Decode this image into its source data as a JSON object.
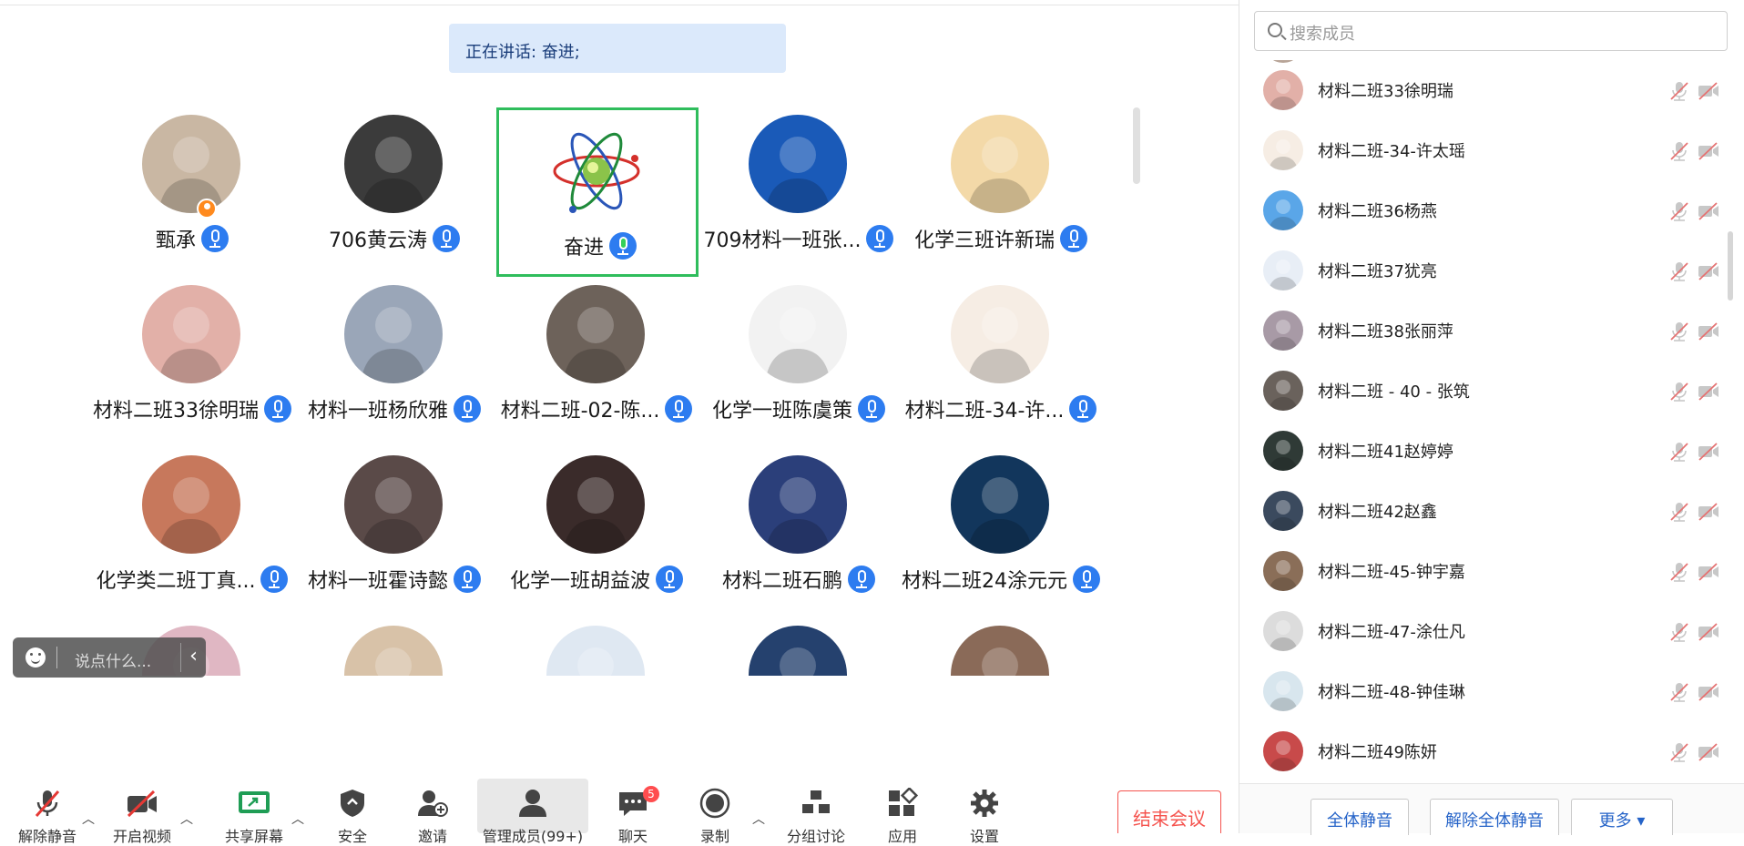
{
  "speaking": {
    "text": "正在讲话: 奋进;"
  },
  "grid": {
    "tiles": [
      {
        "name": "甄承",
        "speaking": false,
        "host": true,
        "color": "#c9b7a3"
      },
      {
        "name": "706黄云涛",
        "speaking": false,
        "host": false,
        "color": "#3b3b3b"
      },
      {
        "name": "奋进",
        "speaking": true,
        "host": false,
        "color": "#ffffff"
      },
      {
        "name": "709材料一班张...",
        "speaking": false,
        "host": false,
        "color": "#1a5ab8"
      },
      {
        "name": "化学三班许新瑞",
        "speaking": false,
        "host": false,
        "color": "#f3d9a8"
      },
      {
        "name": "材料二班33徐明瑞",
        "speaking": false,
        "host": false,
        "color": "#e2b0a8"
      },
      {
        "name": "材料一班杨欣雅",
        "speaking": false,
        "host": false,
        "color": "#9aa6b8"
      },
      {
        "name": "材料二班-02-陈...",
        "speaking": false,
        "host": false,
        "color": "#6d625a"
      },
      {
        "name": "化学一班陈虞策",
        "speaking": false,
        "host": false,
        "color": "#f2f2f2"
      },
      {
        "name": "材料二班-34-许...",
        "speaking": false,
        "host": false,
        "color": "#f6ede4"
      },
      {
        "name": "化学类二班丁真...",
        "speaking": false,
        "host": false,
        "color": "#c7785c"
      },
      {
        "name": "材料一班霍诗懿",
        "speaking": false,
        "host": false,
        "color": "#5a4a48"
      },
      {
        "name": "化学一班胡益波",
        "speaking": false,
        "host": false,
        "color": "#3a2b2a"
      },
      {
        "name": "材料二班石鹏",
        "speaking": false,
        "host": false,
        "color": "#2b3f7a"
      },
      {
        "name": "材料二班24涂元元",
        "speaking": false,
        "host": false,
        "color": "#12365c"
      },
      {
        "name": "",
        "speaking": false,
        "host": false,
        "color": "#e0b7c3"
      },
      {
        "name": "",
        "speaking": false,
        "host": false,
        "color": "#d8c2a8"
      },
      {
        "name": "",
        "speaking": false,
        "host": false,
        "color": "#dfe8f2"
      },
      {
        "name": "",
        "speaking": false,
        "host": false,
        "color": "#25416e"
      },
      {
        "name": "",
        "speaking": false,
        "host": false,
        "color": "#8a6a58"
      }
    ]
  },
  "chat": {
    "placeholder": "说点什么..."
  },
  "toolbar": {
    "unmute": "解除静音",
    "video": "开启视频",
    "share": "共享屏幕",
    "security": "安全",
    "invite": "邀请",
    "members": "管理成员(99+)",
    "chat": "聊天",
    "chat_count": "5",
    "record": "录制",
    "breakout": "分组讨论",
    "apps": "应用",
    "settings": "设置",
    "end": "结束会议"
  },
  "panel": {
    "search_placeholder": "搜索成员",
    "members": [
      {
        "name": "材料二班33徐明瑞",
        "color": "#e2b0a8"
      },
      {
        "name": "材料二班-34-许太瑶",
        "color": "#f6ede4"
      },
      {
        "name": "材料二班36杨燕",
        "color": "#5aa6e8"
      },
      {
        "name": "材料二班37犹亮",
        "color": "#e8eef6"
      },
      {
        "name": "材料二班38张丽萍",
        "color": "#a89aa6"
      },
      {
        "name": "材料二班 - 40 - 张筑",
        "color": "#6a625c"
      },
      {
        "name": "材料二班41赵婷婷",
        "color": "#2f3a36"
      },
      {
        "name": "材料二班42赵鑫",
        "color": "#3b4a5e"
      },
      {
        "name": "材料二班-45-钟宇嘉",
        "color": "#8a6e58"
      },
      {
        "name": "材料二班-47-涂仕凡",
        "color": "#dcdcdc"
      },
      {
        "name": "材料二班-48-钟佳琳",
        "color": "#d8e6ee"
      },
      {
        "name": "材料二班49陈妍",
        "color": "#c84a4a"
      }
    ],
    "mute_all": "全体静音",
    "unmute_all": "解除全体静音",
    "more": "更多 ▾"
  }
}
